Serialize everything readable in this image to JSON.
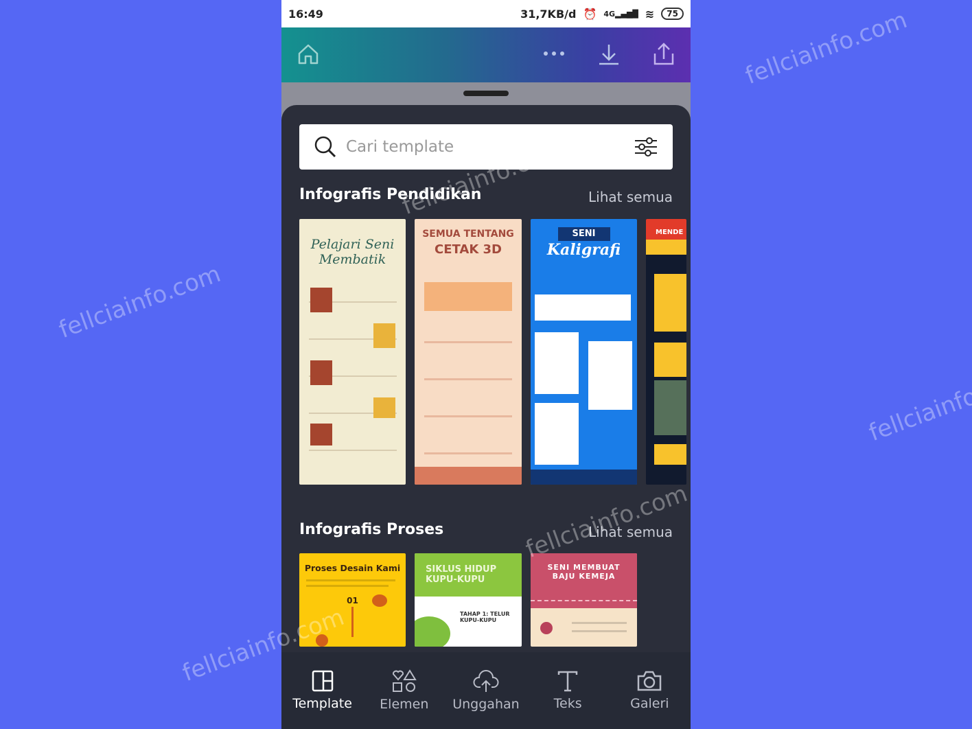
{
  "watermark": "fellciainfo.com",
  "status_bar": {
    "time": "16:49",
    "speed": "31,7KB/d",
    "network": "4G",
    "battery": "75"
  },
  "topbar": {
    "icons": [
      "home-icon",
      "more-icon",
      "download-icon",
      "share-icon"
    ]
  },
  "search": {
    "placeholder": "Cari template",
    "icon": "search-icon",
    "filter_icon": "filter-icon"
  },
  "sections": [
    {
      "title": "Infografis Pendidikan",
      "see_all": "Lihat semua",
      "cards": [
        {
          "title": "Pelajari Seni Membatik"
        },
        {
          "title": "SEMUA TENTANG",
          "subtitle": "CETAK 3D"
        },
        {
          "title": "SENI",
          "subtitle": "Kaligrafi"
        },
        {
          "title": "MENDE"
        }
      ]
    },
    {
      "title": "Infografis Proses",
      "see_all": "Lihat semua",
      "cards": [
        {
          "title": "Proses Desain Kami",
          "subtitle": "01"
        },
        {
          "title": "SIKLUS HIDUP KUPU-KUPU",
          "subtitle": "TAHAP 1: TELUR KUPU-KUPU"
        },
        {
          "title": "SENI MEMBUAT BAJU KEMEJA"
        }
      ]
    }
  ],
  "nav": [
    {
      "label": "Template",
      "icon": "template-icon",
      "active": true
    },
    {
      "label": "Elemen",
      "icon": "elements-icon"
    },
    {
      "label": "Unggahan",
      "icon": "upload-cloud-icon"
    },
    {
      "label": "Teks",
      "icon": "text-icon"
    },
    {
      "label": "Galeri",
      "icon": "camera-icon"
    }
  ],
  "colors": {
    "background": "#5567f4",
    "panel": "#2b2e3a"
  }
}
